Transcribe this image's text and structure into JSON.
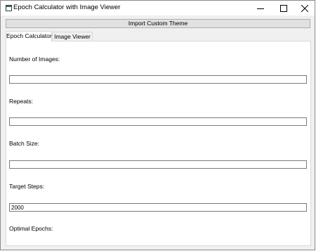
{
  "window": {
    "title": "Epoch Calculator with Image Viewer"
  },
  "toolbar": {
    "import_theme_label": "Import Custom Theme"
  },
  "tabs": [
    {
      "label": "Epoch Calculator",
      "active": true
    },
    {
      "label": "Image Viewer",
      "active": false
    }
  ],
  "form": {
    "num_images_label": "Number of Images:",
    "num_images_value": "",
    "repeats_label": "Repeats:",
    "repeats_value": "",
    "batch_size_label": "Batch Size:",
    "batch_size_value": "",
    "target_steps_label": "Target Steps:",
    "target_steps_value": "2000",
    "optimal_epochs_label": "Optimal Epochs:"
  },
  "icons": {
    "app": "window-icon",
    "minimize": "minimize-icon",
    "maximize": "maximize-icon",
    "close": "close-icon"
  }
}
